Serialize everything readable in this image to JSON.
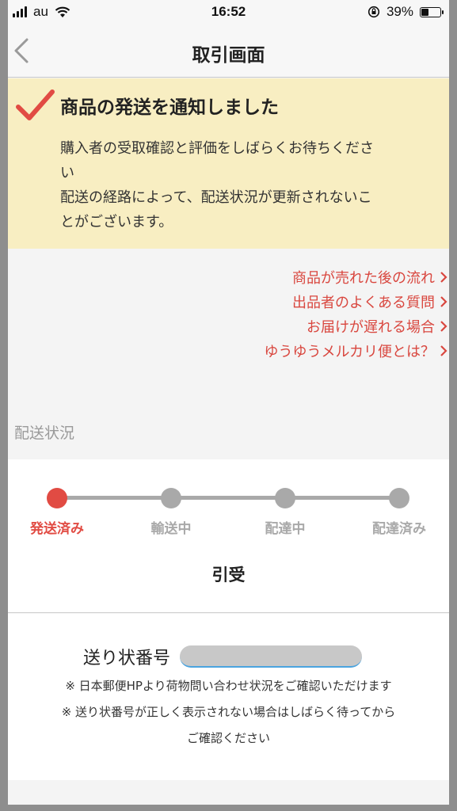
{
  "status_bar": {
    "carrier": "au",
    "time": "16:52",
    "battery_percent": "39%",
    "battery_level": 0.39
  },
  "nav": {
    "title": "取引画面"
  },
  "notice": {
    "title": "商品の発送を通知しました",
    "line1": "購入者の受取確認と評価をしばらくお待ちくださ",
    "line2": "い",
    "line3": "配送の経路によって、配送状況が更新されないこ",
    "line4": "とがございます。"
  },
  "links": [
    {
      "label": "商品が売れた後の流れ"
    },
    {
      "label": "出品者のよくある質問"
    },
    {
      "label": "お届けが遅れる場合"
    },
    {
      "label": "ゆうゆうメルカリ便とは？"
    }
  ],
  "shipping_section": {
    "label": "配送状況"
  },
  "progress": {
    "steps": [
      {
        "label": "発送済み",
        "active": true
      },
      {
        "label": "輸送中",
        "active": false
      },
      {
        "label": "配達中",
        "active": false
      },
      {
        "label": "配達済み",
        "active": false
      }
    ],
    "current_status": "引受"
  },
  "tracking": {
    "label": "送り状番号",
    "note1": "※ 日本郵便HPより荷物問い合わせ状況をご確認いただけます",
    "note2": "※ 送り状番号が正しく表示されない場合はしばらく待ってから",
    "note3": "ご確認ください"
  },
  "colors": {
    "accent": "#e14b43",
    "notice_bg": "#f8eec2",
    "inactive": "#a9a9a9"
  }
}
